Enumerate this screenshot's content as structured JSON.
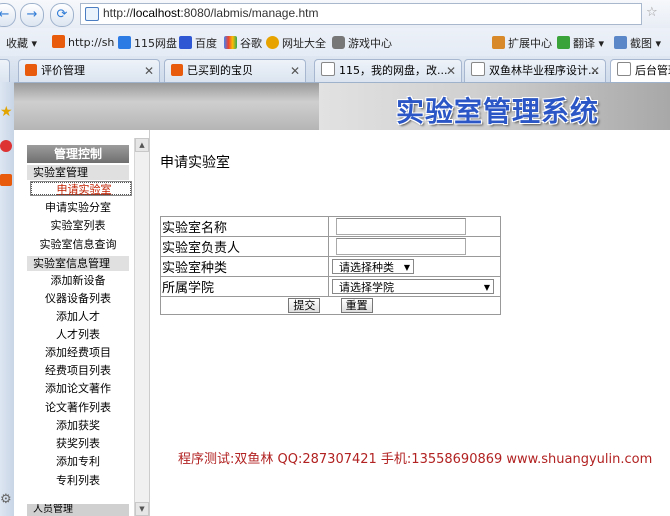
{
  "browser": {
    "url_prefix": "http://",
    "url_host": "localhost",
    "url_rest": ":8080/labmis/manage.htm",
    "bookmarks": [
      "收藏",
      "http://sh",
      "115网盘",
      "百度",
      "谷歌",
      "网址大全",
      "游戏中心"
    ],
    "toolbar_right": [
      "扩展中心",
      "翻译",
      "截图"
    ],
    "tabs": [
      {
        "label": "评价管理",
        "active": false
      },
      {
        "label": "已买到的宝贝",
        "active": false
      },
      {
        "label": "115，我的网盘，改...",
        "active": false
      },
      {
        "label": "双鱼林毕业程序设计...",
        "active": false
      },
      {
        "label": "后台管理",
        "active": true
      }
    ]
  },
  "site": {
    "title": "实验室管理系统"
  },
  "nav": {
    "header": "管理控制",
    "groups": [
      {
        "label": "实验室管理",
        "items": [
          "申请实验室",
          "申请实验分室",
          "实验室列表",
          "实验室信息查询"
        ]
      },
      {
        "label": "实验室信息管理",
        "items": [
          "添加新设备",
          "仪器设备列表",
          "添加人才",
          "人才列表",
          "添加经费项目",
          "经费项目列表",
          "添加论文著作",
          "论文著作列表",
          "添加获奖",
          "获奖列表",
          "添加专利",
          "专利列表"
        ]
      }
    ],
    "bottom_group": "人员管理",
    "selected": "申请实验室"
  },
  "main": {
    "page_title": "申请实验室",
    "form": {
      "name_label": "实验室名称",
      "owner_label": "实验室负责人",
      "type_label": "实验室种类",
      "type_select": "请选择种类",
      "college_label": "所属学院",
      "college_select": "请选择学院",
      "submit": "提交",
      "reset": "重置"
    },
    "footer": "程序测试:双鱼林 QQ:287307421 手机:13558690869 www.shuangyulin.com"
  },
  "colors": {
    "title_blue": "#2b57c6",
    "footer_red": "#b22222",
    "link_selected": "#c02000"
  }
}
